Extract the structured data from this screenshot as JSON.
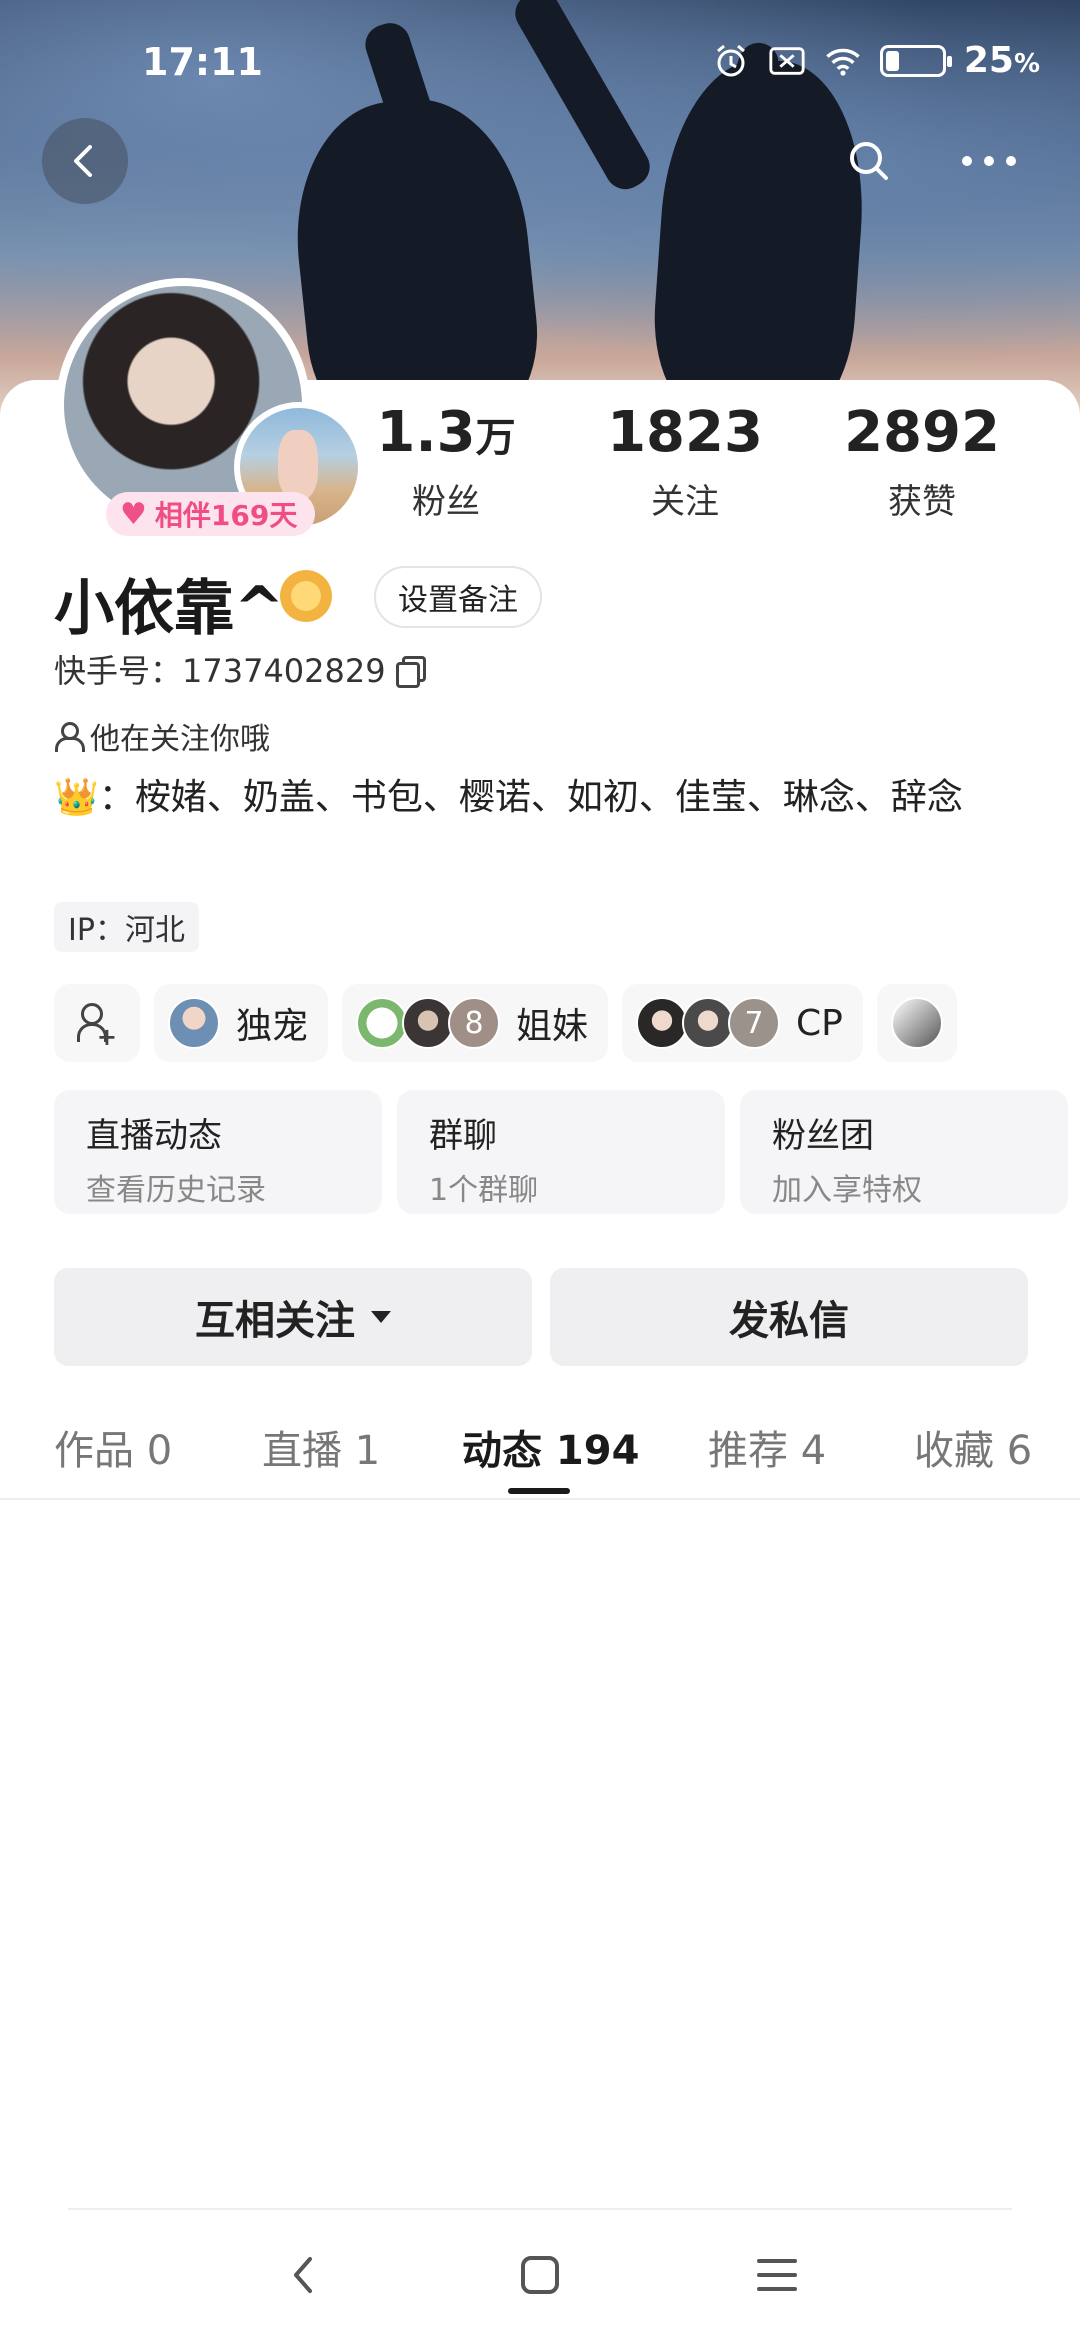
{
  "status_bar": {
    "time": "17:11",
    "battery_pct": "25",
    "battery_suffix": "%",
    "battery_level": 0.25
  },
  "nav": {
    "back_icon": "back-arrow-icon",
    "search_icon": "search-icon",
    "more_icon": "more-icon"
  },
  "profile": {
    "companion_days": "相伴169天",
    "name": "小依靠^",
    "remark_button": "设置备注",
    "kwai_id": "快手号：1737402829",
    "follows_you": "他在关注你哦",
    "bio": "👑：桉媎、奶盖、书包、樱诺、如初、佳莹、琳念、辞念",
    "ip": "IP：河北"
  },
  "stats": [
    {
      "num": "1.3",
      "unit": "万",
      "label": "粉丝"
    },
    {
      "num": "1823",
      "unit": "",
      "label": "关注"
    },
    {
      "num": "2892",
      "unit": "",
      "label": "获赞"
    }
  ],
  "relations": [
    {
      "label": "独宠"
    },
    {
      "label": "姐妹",
      "count": "8"
    },
    {
      "label": "CP",
      "count": "7"
    }
  ],
  "info_cards": [
    {
      "title": "直播动态",
      "sub": "查看历史记录"
    },
    {
      "title": "群聊",
      "sub": "1个群聊"
    },
    {
      "title": "粉丝团",
      "sub": "加入享特权"
    }
  ],
  "actions": {
    "mutual": "互相关注",
    "message": "发私信"
  },
  "tabs": [
    {
      "label": "作品 0"
    },
    {
      "label": "直播 1"
    },
    {
      "label": "动态 194",
      "active": true
    },
    {
      "label": "推荐 4"
    },
    {
      "label": "收藏 6"
    }
  ],
  "colors": {
    "accent_pink": "#ef4d83",
    "badge_bg": "#fde3ee"
  }
}
